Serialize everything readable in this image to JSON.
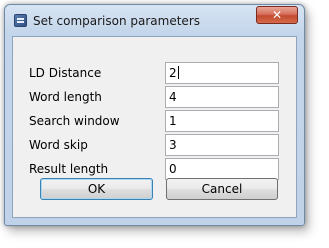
{
  "window": {
    "title": "Set comparison parameters",
    "close_label": "✕"
  },
  "form": {
    "fields": [
      {
        "label": "LD Distance",
        "value": "2"
      },
      {
        "label": "Word length",
        "value": "4"
      },
      {
        "label": "Search window",
        "value": "1"
      },
      {
        "label": "Word skip",
        "value": "3"
      },
      {
        "label": "Result length",
        "value": "0"
      }
    ]
  },
  "buttons": {
    "ok_label": "OK",
    "cancel_label": "Cancel"
  }
}
